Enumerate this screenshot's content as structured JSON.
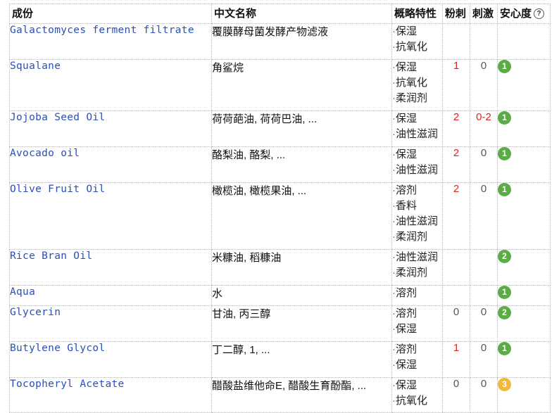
{
  "headers": {
    "name": "成份",
    "cn_name": "中文名称",
    "properties": "概略特性",
    "acne": "粉刺",
    "irritation": "刺激",
    "safety": "安心度"
  },
  "colors": {
    "green": "#5aac44",
    "orange": "#f0b93a",
    "link": "#2b4fb8",
    "red": "#dd2222"
  },
  "rows": [
    {
      "name": "Galactomyces ferment filtrate",
      "cn": "覆膜酵母菌发酵产物滤液",
      "props": [
        "保湿",
        "抗氧化"
      ],
      "acne": "",
      "irritation": "",
      "safety": "",
      "safety_color": ""
    },
    {
      "name": "Squalane",
      "cn": "角鲨烷",
      "props": [
        "保湿",
        "抗氧化",
        "柔润剂"
      ],
      "acne": "1",
      "irritation": "0",
      "safety": "1",
      "safety_color": "#5aac44"
    },
    {
      "name": "Jojoba Seed Oil",
      "cn": "荷荷葩油, 荷荷巴油, ...",
      "props": [
        "保湿",
        "油性滋润"
      ],
      "acne": "2",
      "irritation": "0-2",
      "safety": "1",
      "safety_color": "#5aac44"
    },
    {
      "name": "Avocado oil",
      "cn": "酪梨油, 酪梨, ...",
      "props": [
        "保湿",
        "油性滋润"
      ],
      "acne": "2",
      "irritation": "0",
      "safety": "1",
      "safety_color": "#5aac44"
    },
    {
      "name": "Olive Fruit Oil",
      "cn": "橄榄油, 橄榄果油, ...",
      "props": [
        "溶剂",
        "香料",
        "油性滋润",
        "柔润剂"
      ],
      "acne": "2",
      "irritation": "0",
      "safety": "1",
      "safety_color": "#5aac44"
    },
    {
      "name": "Rice Bran Oil",
      "cn": "米糠油, 稻糠油",
      "props": [
        "油性滋润",
        "柔润剂"
      ],
      "acne": "",
      "irritation": "",
      "safety": "2",
      "safety_color": "#5aac44"
    },
    {
      "name": "Aqua",
      "cn": "水",
      "props": [
        "溶剂"
      ],
      "acne": "",
      "irritation": "",
      "safety": "1",
      "safety_color": "#5aac44"
    },
    {
      "name": "Glycerin",
      "cn": "甘油, 丙三醇",
      "props": [
        "溶剂",
        "保湿"
      ],
      "acne": "0",
      "irritation": "0",
      "safety": "2",
      "safety_color": "#5aac44"
    },
    {
      "name": "Butylene Glycol",
      "cn": "丁二醇, 1, ...",
      "props": [
        "溶剂",
        "保湿"
      ],
      "acne": "1",
      "irritation": "0",
      "safety": "1",
      "safety_color": "#5aac44"
    },
    {
      "name": "Tocopheryl Acetate",
      "cn": "醋酸盐维他命E, 醋酸生育酚酯, ...",
      "props": [
        "保湿",
        "抗氧化"
      ],
      "acne": "0",
      "irritation": "0",
      "safety": "3",
      "safety_color": "#f0b93a"
    }
  ]
}
